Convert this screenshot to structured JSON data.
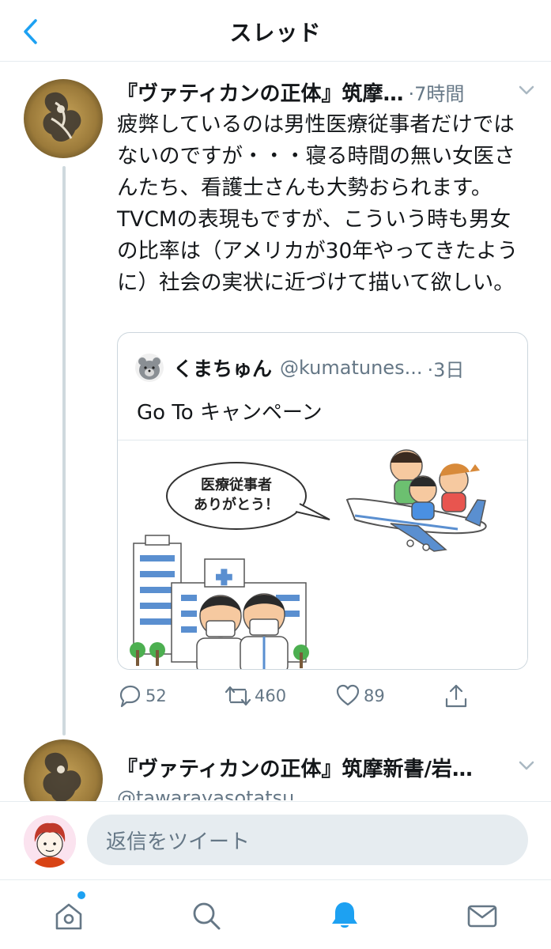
{
  "header": {
    "title": "スレッド",
    "back_icon": "chevron-left-icon"
  },
  "tweet": {
    "author_name": "『ヴァティカンの正体』筑摩…",
    "time": "·7時間",
    "text": "疲弊しているのは男性医療従事者だけではないのですが・・・寝る時間の無い女医さんたち、看護士さんも大勢おられます。TVCMの表現もですが、こういう時も男女の比率は（アメリカが30年やってきたように）社会の実状に近づけて描いて欲しい。",
    "quote": {
      "name": "くまちゅん",
      "handle": "@kumatunes...",
      "time": "·3日",
      "text": "Go To キャンペーン",
      "media": {
        "speech_line1": "医療従事者",
        "speech_line2": "ありがとう！"
      }
    },
    "actions": {
      "reply_count": "52",
      "retweet_count": "460",
      "like_count": "89"
    }
  },
  "tweet2": {
    "author_name": "『ヴァティカンの正体』筑摩新書/岩…",
    "handle": "@tawarayasotatsu"
  },
  "composer": {
    "placeholder": "返信をツイート"
  },
  "colors": {
    "accent": "#1da1f2",
    "secondary_text": "#657786",
    "border": "#e6ecf0"
  }
}
